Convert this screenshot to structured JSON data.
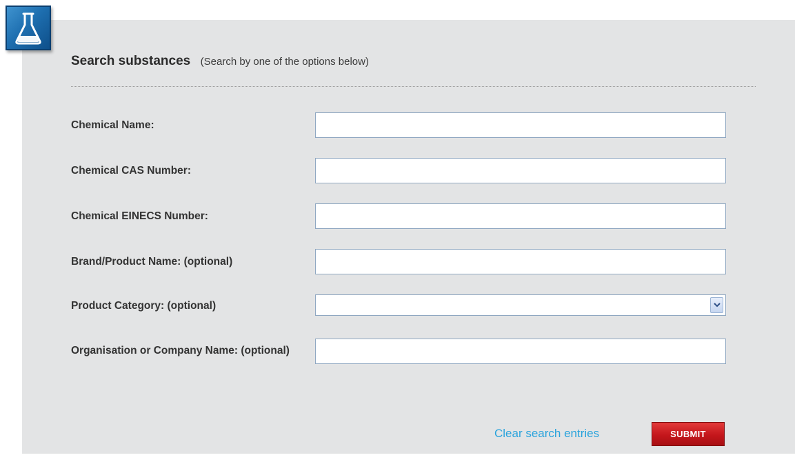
{
  "form": {
    "title": "Search substances",
    "subtitle": "(Search by one of the options below)",
    "icon": "flask-icon",
    "fields": [
      {
        "label": "Chemical Name:",
        "value": ""
      },
      {
        "label": "Chemical CAS Number:",
        "value": ""
      },
      {
        "label": "Chemical EINECS Number:",
        "value": ""
      },
      {
        "label": "Brand/Product Name: (optional)",
        "value": ""
      },
      {
        "label": "Product Category: (optional)",
        "selected": ""
      },
      {
        "label": "Organisation or Company Name: (optional)",
        "value": ""
      }
    ],
    "actions": {
      "clear_label": "Clear search entries",
      "submit_label": "SUBMIT"
    }
  },
  "colors": {
    "panel_background": "#e3e4e5",
    "badge_blue": "#1e6fb0",
    "link_blue": "#2aa3dc",
    "submit_red": "#c4161b"
  }
}
